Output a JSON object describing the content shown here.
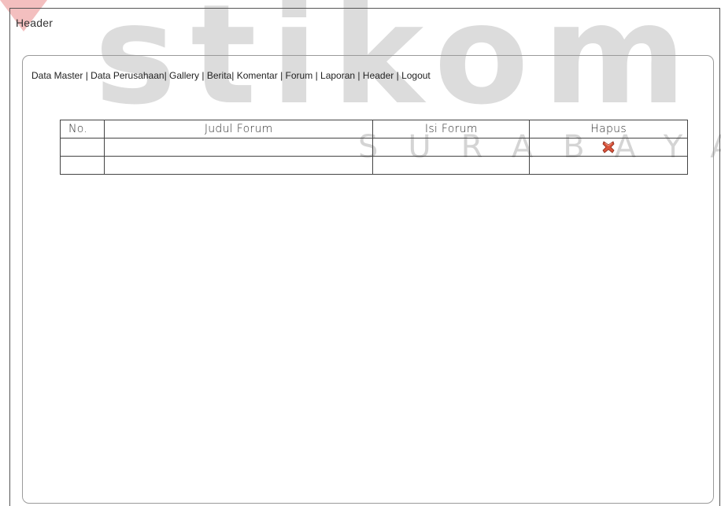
{
  "header": {
    "title": "Header"
  },
  "nav": {
    "items": [
      {
        "label": "Data Master"
      },
      {
        "label": "Data Perusahaan"
      },
      {
        "label": "Gallery"
      },
      {
        "label": "Berita"
      },
      {
        "label": "Komentar"
      },
      {
        "label": "Forum"
      },
      {
        "label": "Laporan"
      },
      {
        "label": "Header"
      },
      {
        "label": "Logout"
      }
    ],
    "separator": "|"
  },
  "table": {
    "columns": [
      "No.",
      "Judul Forum",
      "Isi Forum",
      "Hapus"
    ],
    "rows": [
      {
        "no": "",
        "judul": "",
        "isi": "",
        "hapus_icon": "delete-x-icon"
      },
      {
        "no": "",
        "judul": "",
        "isi": "",
        "hapus_icon": ""
      }
    ]
  },
  "watermark": {
    "logo": "stikom",
    "subtitle": "SURABAYA"
  },
  "colors": {
    "watermark": "#d9d9d9",
    "delete_icon": "#d9533b"
  }
}
